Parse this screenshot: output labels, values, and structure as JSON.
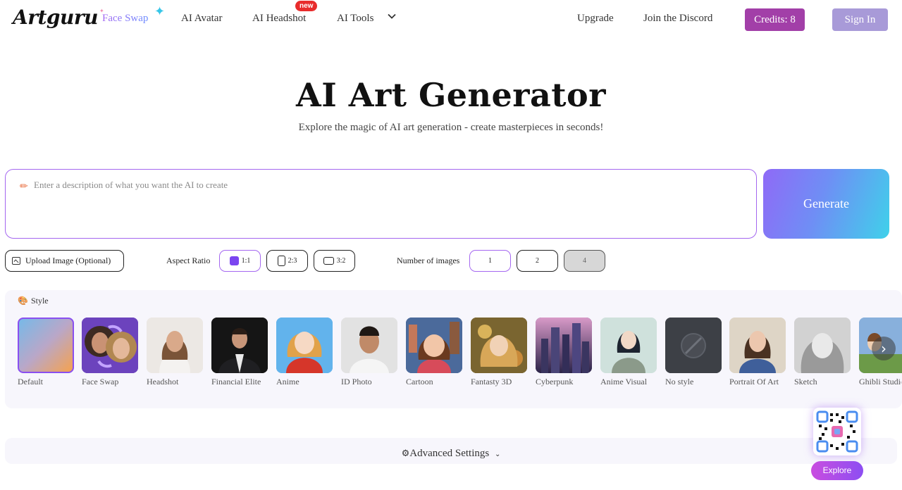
{
  "nav": {
    "logo": "Artguru",
    "links": {
      "face_swap": "Face Swap",
      "ai_avatar": "AI Avatar",
      "ai_headshot": "AI Headshot",
      "ai_headshot_badge": "new",
      "ai_tools": "AI Tools",
      "upgrade": "Upgrade",
      "discord": "Join the Discord"
    },
    "credits": "Credits: 8",
    "sign_in": "Sign In"
  },
  "hero": {
    "title": "AI Art Generator",
    "subtitle": "Explore the magic of AI art generation - create masterpieces in seconds!"
  },
  "prompt": {
    "placeholder": "Enter a description of what you want the AI to create",
    "value": "",
    "generate_label": "Generate"
  },
  "options": {
    "upload_label": "Upload Image (Optional)",
    "aspect_ratio_label": "Aspect Ratio",
    "aspect_ratios": [
      "1:1",
      "2:3",
      "3:2"
    ],
    "aspect_selected": "1:1",
    "num_images_label": "Number of images",
    "num_images": [
      "1",
      "2",
      "4"
    ],
    "num_selected": "1"
  },
  "style": {
    "heading": "Style",
    "selected": "Default",
    "items": [
      {
        "name": "Default"
      },
      {
        "name": "Face Swap"
      },
      {
        "name": "Headshot"
      },
      {
        "name": "Financial Elite"
      },
      {
        "name": "Anime"
      },
      {
        "name": "ID Photo"
      },
      {
        "name": "Cartoon"
      },
      {
        "name": "Fantasty 3D"
      },
      {
        "name": "Cyberpunk"
      },
      {
        "name": "Anime Visual"
      },
      {
        "name": "No style"
      },
      {
        "name": "Portrait Of Art"
      },
      {
        "name": "Sketch"
      },
      {
        "name": "Ghibli Studio"
      }
    ]
  },
  "advanced_settings": "Advanced Settings",
  "explore_label": "Explore",
  "colors": {
    "accent_purple": "#a467f0",
    "credits_bg": "#a23fa8",
    "signin_bg": "#a89ad8"
  }
}
